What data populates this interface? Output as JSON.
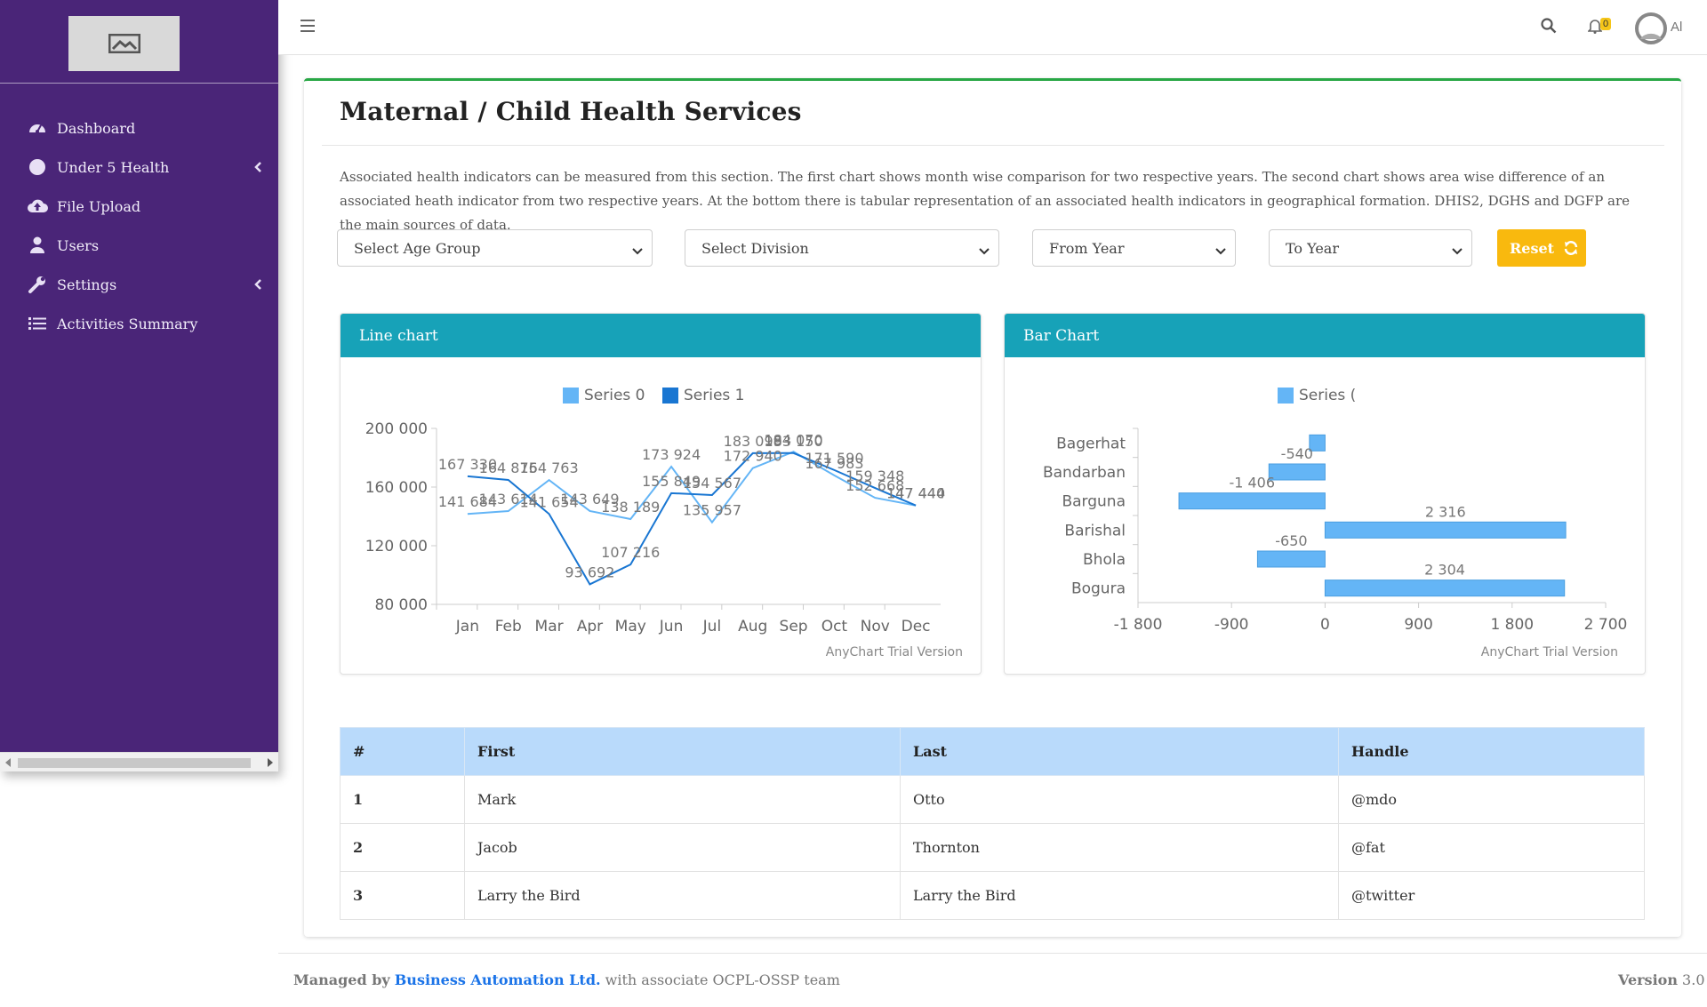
{
  "sidebar": {
    "items": [
      {
        "label": "Dashboard",
        "icon": "tachometer-icon"
      },
      {
        "label": "Under 5 Health",
        "icon": "circle-icon",
        "has_submenu": true
      },
      {
        "label": "File Upload",
        "icon": "cloud-upload-icon"
      },
      {
        "label": "Users",
        "icon": "user-icon"
      },
      {
        "label": "Settings",
        "icon": "wrench-icon",
        "has_submenu": true
      },
      {
        "label": "Activities Summary",
        "icon": "list-icon"
      }
    ]
  },
  "topbar": {
    "notification_count": "0",
    "user_label": "Al"
  },
  "page": {
    "title": "Maternal / Child Health Services",
    "description": "Associated health indicators can be measured from this section. The first chart shows month wise comparison for two respective years. The second chart shows area wise difference of an associated heath indicator from two respective years. At the bottom there is tabular representation of an associated health indicators in geographical formation. DHIS2, DGHS and DGFP are the main sources of data."
  },
  "filters": {
    "age_group": "Select Age Group",
    "division": "Select Division",
    "from_year": "From Year",
    "to_year": "To Year",
    "reset_label": "Reset"
  },
  "colors": {
    "sidebar_bg": "#4a2578",
    "accent_green": "#28a745",
    "chart_header": "#17a2b8",
    "reset_button": "#f9b90e",
    "table_header": "#b9dafb",
    "series0": "#64b5f6",
    "series1": "#1976d2",
    "link": "#1a73e8"
  },
  "chart_data": [
    {
      "type": "line",
      "panel_title": "Line chart",
      "categories": [
        "Jan",
        "Feb",
        "Mar",
        "Apr",
        "May",
        "Jun",
        "Jul",
        "Aug",
        "Sep",
        "Oct",
        "Nov",
        "Dec"
      ],
      "series": [
        {
          "name": "Series 0",
          "values": [
            141684,
            143614,
            164763,
            143649,
            138189,
            173924,
            135957,
            172940,
            184070,
            167983,
            152668,
            147440
          ]
        },
        {
          "name": "Series 1",
          "values": [
            167330,
            164875,
            141654,
            93692,
            107216,
            155849,
            154567,
            183099,
            183150,
            171590,
            159348,
            147444
          ]
        }
      ],
      "y_ticks": [
        "80 000",
        "120 000",
        "160 000",
        "200 000"
      ],
      "y_values": [
        80000,
        120000,
        160000,
        200000
      ],
      "ylim": [
        80000,
        200000
      ],
      "legend_position": "top",
      "data_labels": [
        {
          "series": 0,
          "index": 0,
          "text": "141 684"
        },
        {
          "series": 1,
          "index": 0,
          "text": "167 330"
        },
        {
          "series": 0,
          "index": 1,
          "text": "143 614"
        },
        {
          "series": 1,
          "index": 1,
          "text": "164 875"
        },
        {
          "series": 0,
          "index": 2,
          "text": "164 763"
        },
        {
          "series": 1,
          "index": 2,
          "text": "141 654"
        },
        {
          "series": 0,
          "index": 3,
          "text": "143 649"
        },
        {
          "series": 1,
          "index": 3,
          "text": "93 692"
        },
        {
          "series": 0,
          "index": 4,
          "text": "138 189"
        },
        {
          "series": 1,
          "index": 4,
          "text": "107 216"
        },
        {
          "series": 0,
          "index": 5,
          "text": "173 924"
        },
        {
          "series": 1,
          "index": 5,
          "text": "155 849"
        },
        {
          "series": 0,
          "index": 6,
          "text": "135 957"
        },
        {
          "series": 1,
          "index": 6,
          "text": "154 567"
        },
        {
          "series": 0,
          "index": 7,
          "text": "172 940"
        },
        {
          "series": 1,
          "index": 7,
          "text": "183 099"
        },
        {
          "series": 0,
          "index": 8,
          "text": "184 070"
        },
        {
          "series": 1,
          "index": 8,
          "text": "183 150"
        },
        {
          "series": 0,
          "index": 9,
          "text": "167 983"
        },
        {
          "series": 1,
          "index": 9,
          "text": "171 590"
        },
        {
          "series": 0,
          "index": 10,
          "text": "152 668"
        },
        {
          "series": 1,
          "index": 10,
          "text": "159 348"
        },
        {
          "series": 0,
          "index": 11,
          "text": "147 440"
        },
        {
          "series": 1,
          "index": 11,
          "text": "147 444"
        }
      ],
      "watermark": "AnyChart Trial Version"
    },
    {
      "type": "bar",
      "orientation": "horizontal",
      "panel_title": "Bar Chart",
      "categories": [
        "Bagerhat",
        "Bandarban",
        "Barguna",
        "Barishal",
        "Bhola",
        "Bogura"
      ],
      "series": [
        {
          "name": "Series (",
          "values": [
            -150,
            -540,
            -1406,
            2316,
            -650,
            2304
          ]
        }
      ],
      "value_labels": [
        "",
        "-540",
        "-1 406",
        "2 316",
        "-650",
        "2 304"
      ],
      "x_ticks": [
        "-1 800",
        "-900",
        "0",
        "900",
        "1 800",
        "2 700"
      ],
      "x_values": [
        -1800,
        -900,
        0,
        900,
        1800,
        2700
      ],
      "xlim": [
        -1800,
        2700
      ],
      "legend_position": "top",
      "watermark": "AnyChart Trial Version"
    }
  ],
  "table": {
    "headers": [
      "#",
      "First",
      "Last",
      "Handle"
    ],
    "rows": [
      [
        "1",
        "Mark",
        "Otto",
        "@mdo"
      ],
      [
        "2",
        "Jacob",
        "Thornton",
        "@fat"
      ],
      [
        "3",
        "Larry the Bird",
        "Larry the Bird",
        "@twitter"
      ]
    ]
  },
  "footer": {
    "managed_by": "Managed by",
    "company": "Business Automation Ltd.",
    "suffix": "with associate OCPL-OSSP team",
    "version_label": "Version",
    "version_value": "3.0"
  }
}
